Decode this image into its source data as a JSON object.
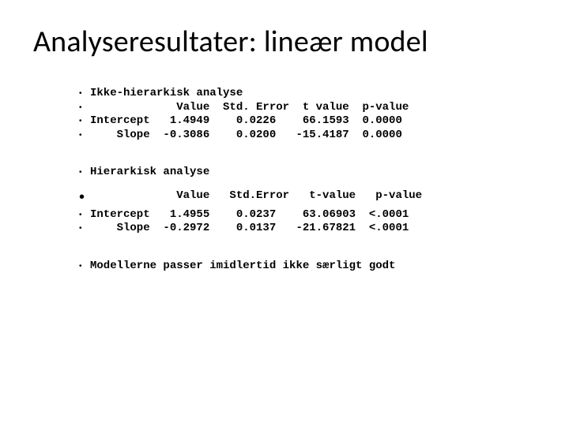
{
  "title": "Analyseresultater: lineær model",
  "block1": {
    "heading": "Ikke-hierarkisk analyse",
    "header": "             Value  Std. Error  t value  p-value",
    "rows": [
      "Intercept   1.4949    0.0226    66.1593  0.0000",
      "    Slope  -0.3086    0.0200   -15.4187  0.0000"
    ]
  },
  "block2": {
    "heading": "Hierarkisk analyse",
    "header": "             Value   Std.Error   t-value   p-value",
    "rows": [
      "Intercept   1.4955    0.0237    63.06903  <.0001",
      "    Slope  -0.2972    0.0137   -21.67821  <.0001"
    ]
  },
  "footer": "Modellerne passer imidlertid ikke særligt godt",
  "chart_data": [
    {
      "type": "table",
      "title": "Ikke-hierarkisk analyse",
      "columns": [
        "",
        "Value",
        "Std. Error",
        "t value",
        "p-value"
      ],
      "rows": [
        [
          "Intercept",
          1.4949,
          0.0226,
          66.1593,
          0.0
        ],
        [
          "Slope",
          -0.3086,
          0.02,
          -15.4187,
          0.0
        ]
      ]
    },
    {
      "type": "table",
      "title": "Hierarkisk analyse",
      "columns": [
        "",
        "Value",
        "Std.Error",
        "t-value",
        "p-value"
      ],
      "rows": [
        [
          "Intercept",
          1.4955,
          0.0237,
          63.06903,
          "<.0001"
        ],
        [
          "Slope",
          -0.2972,
          0.0137,
          -21.67821,
          "<.0001"
        ]
      ]
    }
  ]
}
